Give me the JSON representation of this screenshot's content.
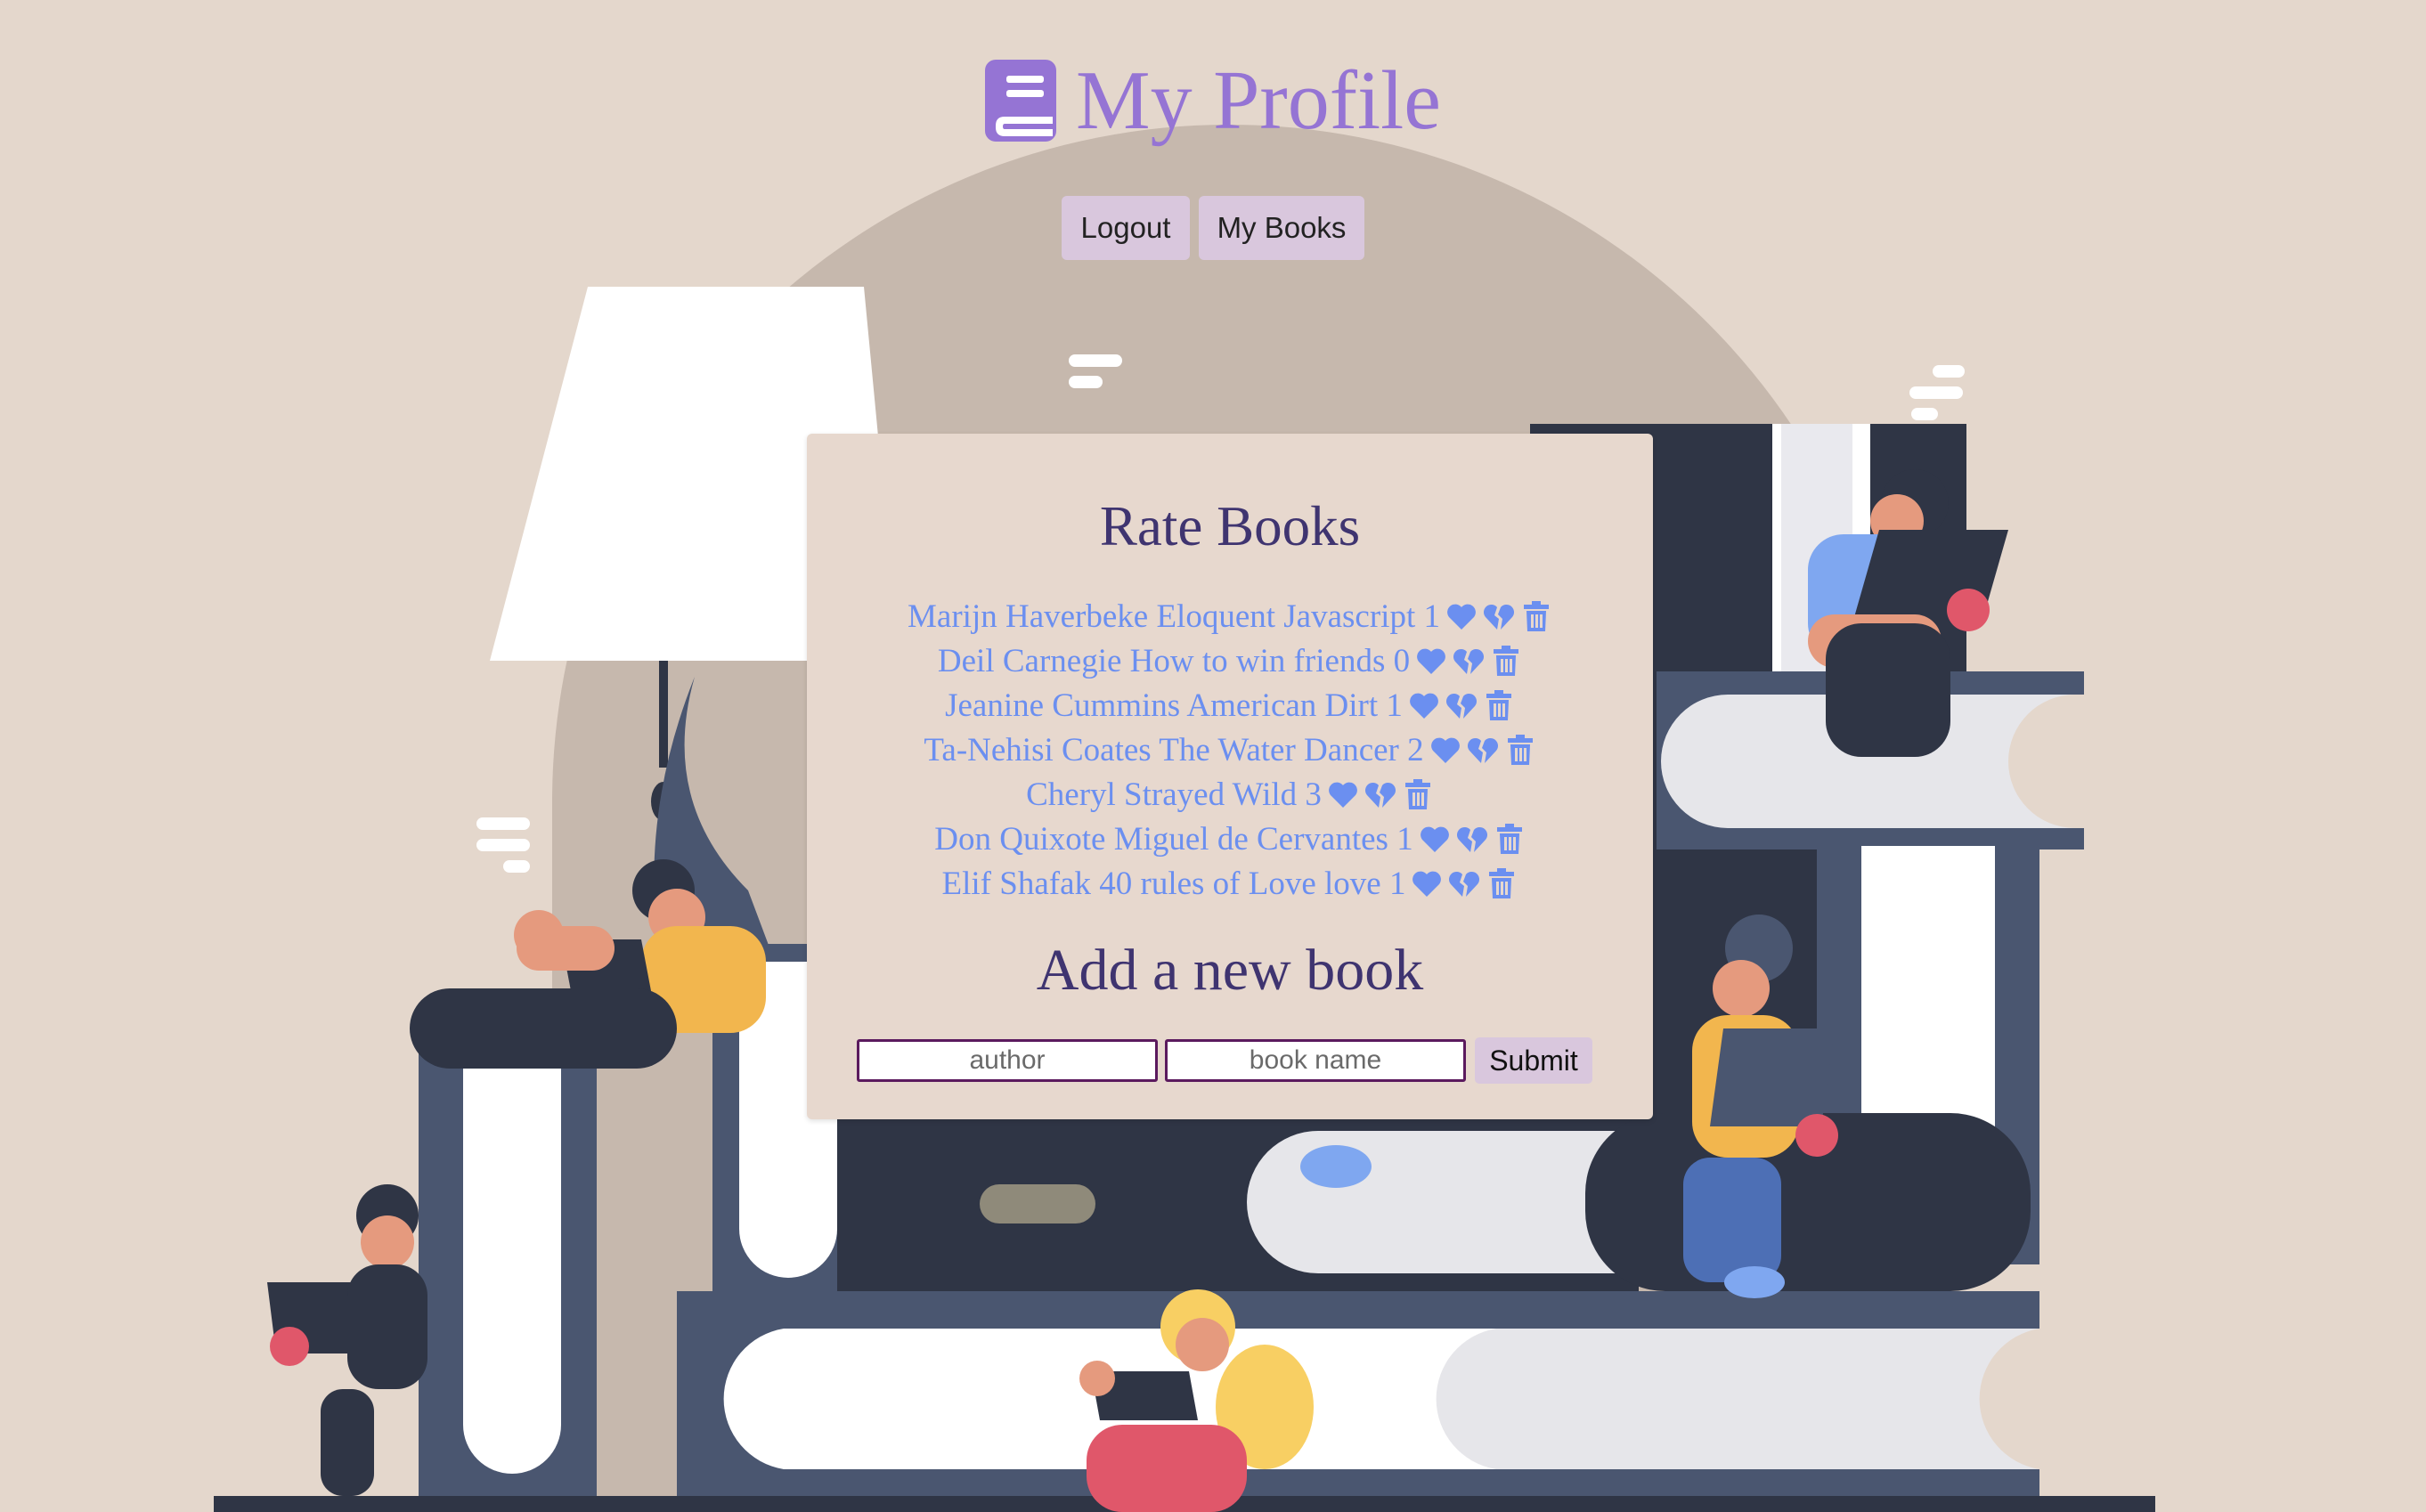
{
  "header": {
    "title": "My Profile",
    "icon": "book-icon"
  },
  "nav": {
    "logout_label": "Logout",
    "my_books_label": "My Books"
  },
  "rate_section": {
    "title": "Rate Books",
    "books": [
      {
        "text": "Marijn Haverbeke Eloquent Javascript 1"
      },
      {
        "text": "Deil Carnegie How to win friends 0"
      },
      {
        "text": "Jeanine Cummins American Dirt 1"
      },
      {
        "text": "Ta-Nehisi Coates The Water Dancer 2"
      },
      {
        "text": "Cheryl Strayed Wild 3"
      },
      {
        "text": "Don Quixote Miguel de Cervantes 1"
      },
      {
        "text": "Elif Shafak 40 rules of Love love 1"
      }
    ],
    "icons": [
      "heart-icon",
      "broken-heart-icon",
      "trash-icon"
    ]
  },
  "add_section": {
    "title": "Add a new book",
    "author_placeholder": "author",
    "book_name_placeholder": "book name",
    "submit_label": "Submit"
  },
  "colors": {
    "background": "#e4d7cc",
    "title": "#9574d4",
    "card": "#e7d8ce",
    "heading": "#3f3470",
    "link": "#6b8ff0",
    "button": "#d9c7dd",
    "input_border": "#5b1a5e"
  }
}
